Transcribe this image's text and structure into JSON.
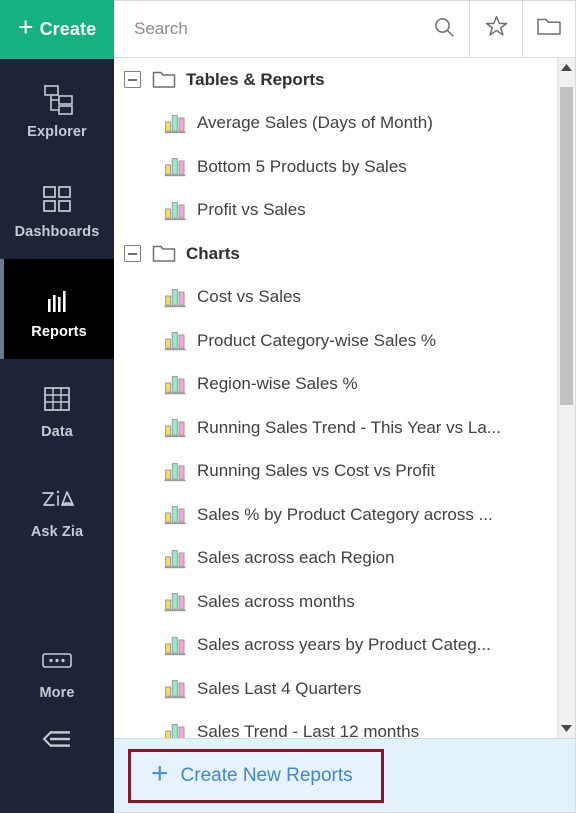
{
  "sidebar": {
    "create_button": {
      "label": "Create",
      "icon": "plus-icon",
      "accent": "#16b183"
    },
    "items": [
      {
        "label": "Explorer",
        "icon": "explorer-tree-icon",
        "active": false
      },
      {
        "label": "Dashboards",
        "icon": "dashboards-grid-icon",
        "active": false
      },
      {
        "label": "Reports",
        "icon": "reports-bars-icon",
        "active": true
      },
      {
        "label": "Data",
        "icon": "data-table-icon",
        "active": false
      },
      {
        "label": "Ask Zia",
        "icon": "ask-zia-icon",
        "active": false
      },
      {
        "label": "More",
        "icon": "more-ellipsis-icon",
        "active": false
      }
    ],
    "collapse": {
      "icon": "collapse-menu-icon"
    }
  },
  "topbar": {
    "search": {
      "placeholder": "Search",
      "value": "",
      "icon": "search-icon"
    },
    "favorites_button": {
      "icon": "star-icon"
    },
    "folder_button": {
      "icon": "folder-icon"
    }
  },
  "tree": {
    "rows": [
      {
        "type": "folder",
        "label": "Tables & Reports",
        "expanded": true,
        "icon": "folder-icon",
        "toggle": "minus-square-icon"
      },
      {
        "type": "report",
        "label": "Average Sales (Days of Month)",
        "icon": "bar-chart-icon"
      },
      {
        "type": "report",
        "label": "Bottom 5 Products by Sales",
        "icon": "bar-chart-icon"
      },
      {
        "type": "report",
        "label": "Profit vs Sales",
        "icon": "bar-chart-icon"
      },
      {
        "type": "folder",
        "label": "Charts",
        "expanded": true,
        "icon": "folder-icon",
        "toggle": "minus-square-icon"
      },
      {
        "type": "report",
        "label": "Cost vs Sales",
        "icon": "bar-chart-icon"
      },
      {
        "type": "report",
        "label": "Product Category-wise Sales %",
        "icon": "bar-chart-icon"
      },
      {
        "type": "report",
        "label": "Region-wise Sales %",
        "icon": "bar-chart-icon"
      },
      {
        "type": "report",
        "label": "Running Sales Trend - This Year vs La...",
        "icon": "bar-chart-icon"
      },
      {
        "type": "report",
        "label": "Running Sales vs Cost vs Profit",
        "icon": "bar-chart-icon"
      },
      {
        "type": "report",
        "label": "Sales % by Product Category across ...",
        "icon": "bar-chart-icon"
      },
      {
        "type": "report",
        "label": "Sales across each Region",
        "icon": "bar-chart-icon"
      },
      {
        "type": "report",
        "label": "Sales across months",
        "icon": "bar-chart-icon"
      },
      {
        "type": "report",
        "label": "Sales across years by Product Categ...",
        "icon": "bar-chart-icon"
      },
      {
        "type": "report",
        "label": "Sales Last 4 Quarters",
        "icon": "bar-chart-icon"
      },
      {
        "type": "report",
        "label": "Sales Trend - Last 12 months",
        "icon": "bar-chart-icon"
      }
    ]
  },
  "scrollbar": {
    "up_icon": "caret-up-icon",
    "down_icon": "caret-down-icon"
  },
  "footer": {
    "create_new_label": "Create New Reports",
    "plus": "+",
    "highlight_color": "#8c1529",
    "link_color": "#3d85d8"
  },
  "icon_colors": {
    "chart_bar_yellow": "#f8dc60",
    "chart_bar_teal": "#8fefcb",
    "chart_bar_pink": "#f4a8d8"
  }
}
